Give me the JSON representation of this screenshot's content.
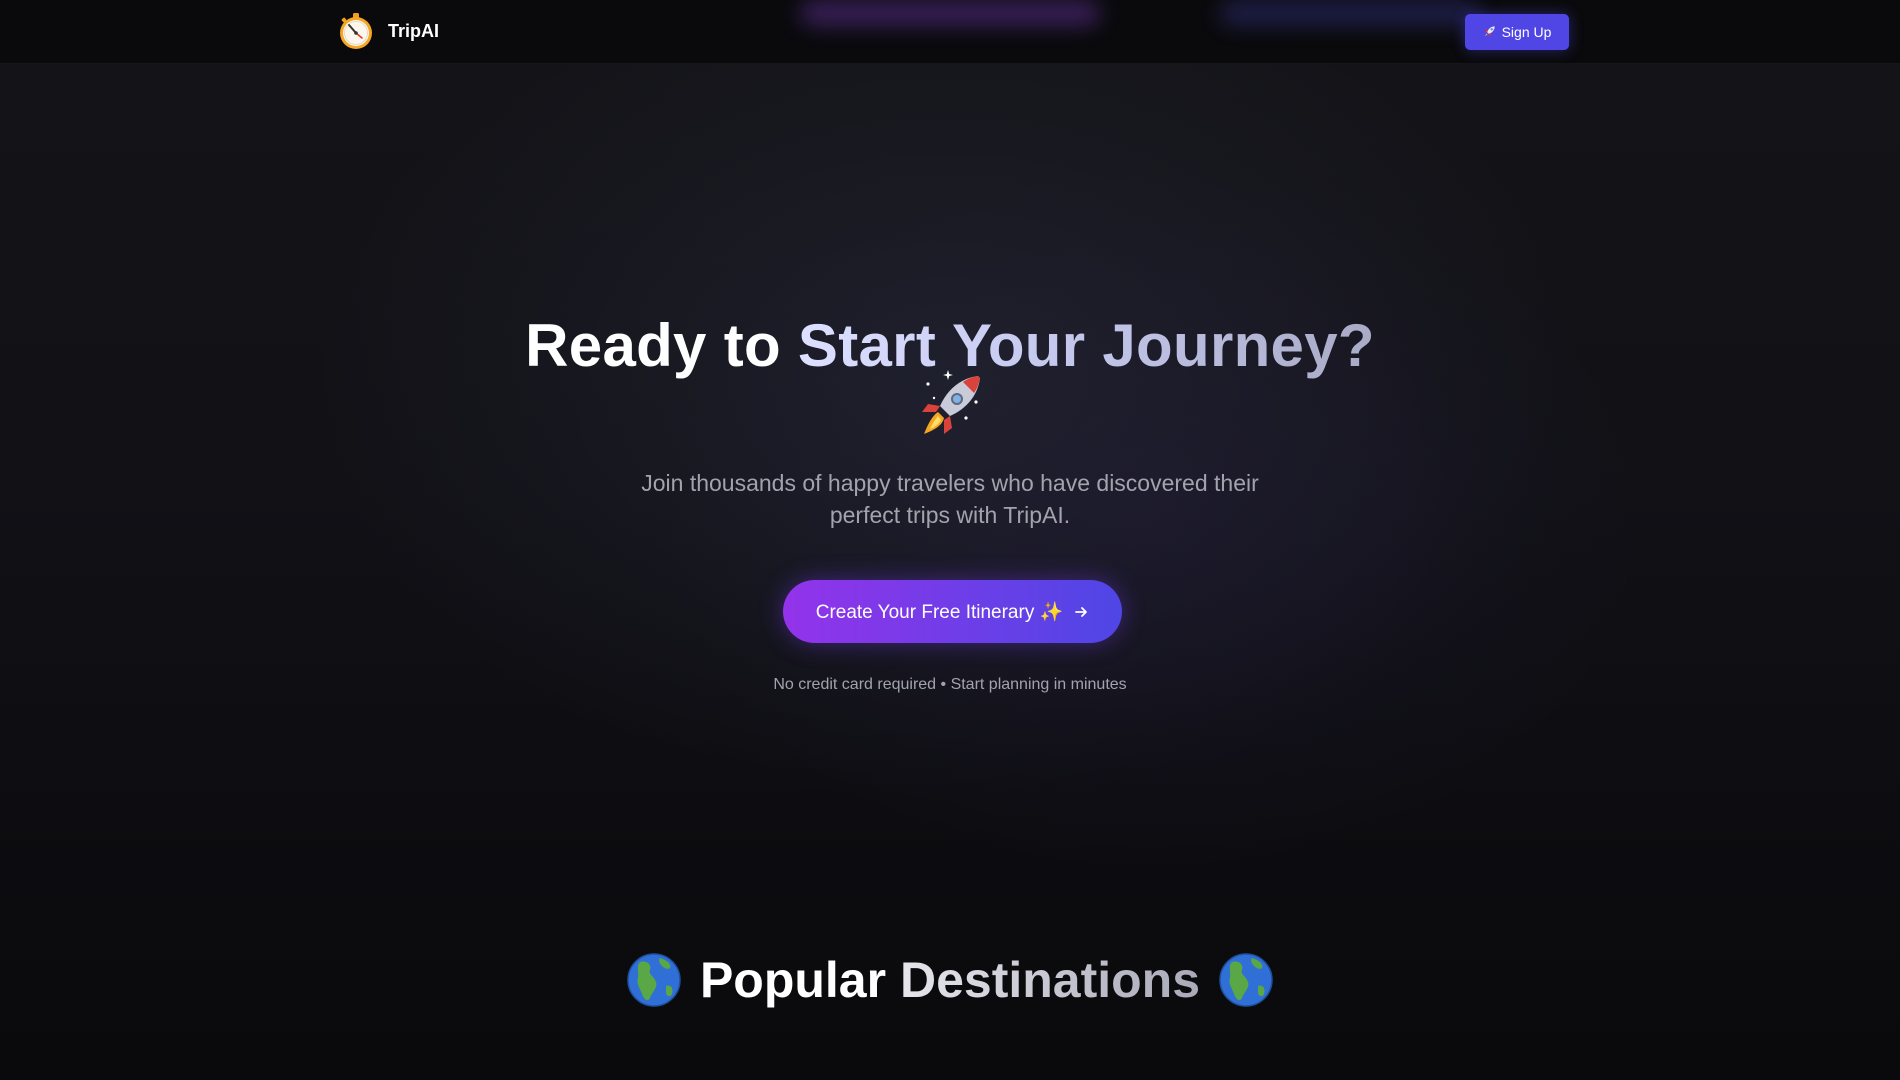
{
  "nav": {
    "brand_name": "TripAI",
    "brand_icon": "stopwatch-icon",
    "signup_label": "Sign Up",
    "signup_icon": "rocket-icon"
  },
  "hero": {
    "title_part1": "Ready to ",
    "title_part2": "Start Your Journey?",
    "title_icon": "rocket-icon",
    "subtitle": "Join thousands of happy travelers who have discovered their perfect trips with TripAI.",
    "cta_label": "Create Your Free Itinerary ✨",
    "cta_icon": "arrow-right-icon",
    "note": "No credit card required • Start planning in minutes"
  },
  "destinations": {
    "title_part1": "Popular",
    "title_part2": "Destinations",
    "title_icon": "globe-icon"
  },
  "colors": {
    "accent_indigo": "#4f46e5",
    "accent_purple": "#9333ea",
    "background": "#0b0b0e",
    "muted_text": "#a3a3ad"
  }
}
